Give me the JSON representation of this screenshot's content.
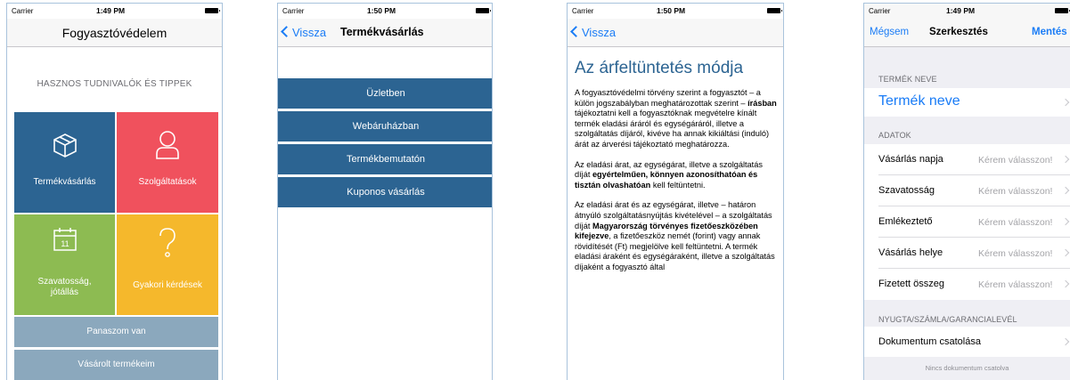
{
  "status_bars": [
    {
      "carrier": "Carrier",
      "time": "1:49 PM"
    },
    {
      "carrier": "Carrier",
      "time": "1:50 PM"
    },
    {
      "carrier": "Carrier",
      "time": "1:50 PM"
    },
    {
      "carrier": "Carrier",
      "time": "1:49 PM"
    }
  ],
  "screen1": {
    "title": "Fogyasztóvédelem",
    "tips_heading": "HASZNOS TUDNIVALÓK ÉS TIPPEK",
    "tiles": [
      {
        "label": "Termékvásárlás",
        "icon": "box-icon",
        "color": "#2c6492"
      },
      {
        "label": "Szolgáltatások",
        "icon": "person-icon",
        "color": "#f0515d"
      },
      {
        "label_line1": "Szavatosság,",
        "label_line2": "jótállás",
        "icon": "calendar-icon",
        "icon_text": "11",
        "color": "#8dbb52"
      },
      {
        "label": "Gyakori kérdések",
        "icon": "question-icon",
        "color": "#f5b82c"
      }
    ],
    "buttons": [
      "Panaszom van",
      "Vásárolt termékeim"
    ]
  },
  "screen2": {
    "back": "Vissza",
    "title": "Termékvásárlás",
    "items": [
      "Üzletben",
      "Webáruházban",
      "Termékbemutatón",
      "Kuponos vásárlás"
    ]
  },
  "screen3": {
    "back": "Vissza",
    "title": "Az árfeltüntetés módja",
    "p1_a": "A fogyasztóvédelmi törvény szerint a fogyasztót – a külön jogszabályban meghatározottak szerint –",
    "p1_b": "írásban",
    "p1_c": "tájékoztatni kell a fogyasztóknak megvételre kínált termék eladási áráról és egységáráról, illetve a szolgáltatás díjáról, kivéve ha annak kikiáltási (induló) árát az árverési tájékoztató meghatározza.",
    "p2_a": "Az eladási árat, az egységárat, illetve a szolgáltatás díját",
    "p2_b": "egyértelműen, könnyen azonosíthatóan és tisztán olvashatóan",
    "p2_c": "kell feltüntetni.",
    "p3_a": "Az eladási árat és az egységárat, illetve – határon átnyúló szolgáltatásnyújtás kivételével – a szolgáltatás díját",
    "p3_b": "Magyarország törvényes fizetőeszközében kifejezve",
    "p3_c": ", a fizetőeszköz nemét (forint) vagy annak rövidítését (Ft) megjelölve kell feltüntetni. A termék eladási áraként és egységáraként, illetve a szolgáltatás díjaként a fogyasztó által"
  },
  "screen4": {
    "cancel": "Mégsem",
    "title": "Szerkesztés",
    "save": "Mentés",
    "section_name": "TERMÉK NEVE",
    "name_placeholder": "Termék neve",
    "section_data": "ADATOK",
    "rows": [
      {
        "key": "Vásárlás napja",
        "value": "Kérem válasszon!"
      },
      {
        "key": "Szavatosság",
        "value": "Kérem válasszon!"
      },
      {
        "key": "Emlékeztető",
        "value": "Kérem válasszon!"
      },
      {
        "key": "Vásárlás helye",
        "value": "Kérem válasszon!"
      },
      {
        "key": "Fizetett összeg",
        "value": "Kérem válasszon!"
      }
    ],
    "section_docs": "NYUGTA/SZÁMLA/GARANCIALEVÉL",
    "attach": "Dokumentum csatolása",
    "no_docs": "Nincs dokumentum csatolva"
  }
}
